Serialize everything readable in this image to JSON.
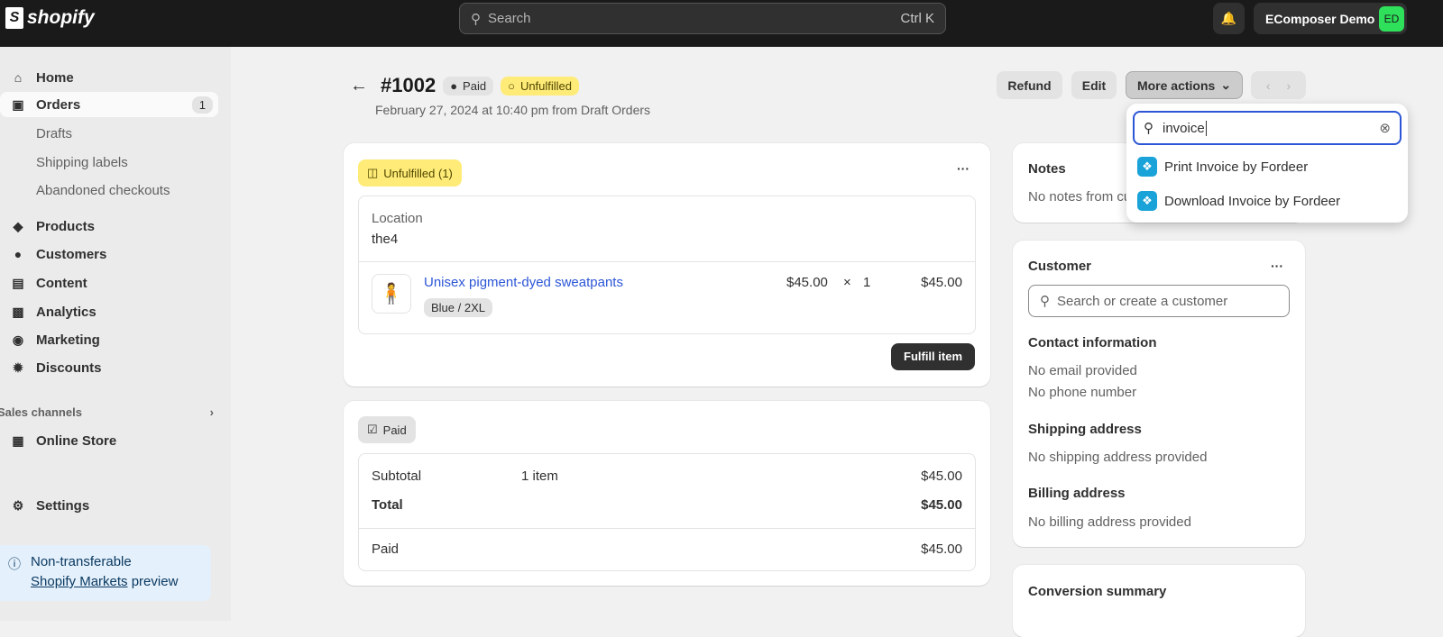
{
  "topbar": {
    "brand": "shopify",
    "search_placeholder": "Search",
    "search_shortcut": "Ctrl K",
    "store_name": "EComposer Demo",
    "store_initials": "ED"
  },
  "sidebar": {
    "items": [
      {
        "label": "Home"
      },
      {
        "label": "Orders",
        "count": "1"
      },
      {
        "label": "Drafts"
      },
      {
        "label": "Shipping labels"
      },
      {
        "label": "Abandoned checkouts"
      },
      {
        "label": "Products"
      },
      {
        "label": "Customers"
      },
      {
        "label": "Content"
      },
      {
        "label": "Analytics"
      },
      {
        "label": "Marketing"
      },
      {
        "label": "Discounts"
      }
    ],
    "sales_channels": "Sales channels",
    "online_store": "Online Store",
    "settings": "Settings",
    "notice": {
      "line1": "Non-transferable",
      "link": "Shopify Markets",
      "after": " preview"
    }
  },
  "order": {
    "number": "#1002",
    "payment_badge": "Paid",
    "fulfillment_badge": "Unfulfilled",
    "date": "February 27, 2024 at 10:40 pm from Draft Orders",
    "actions": {
      "refund": "Refund",
      "edit": "Edit",
      "more": "More actions"
    }
  },
  "fulfillment": {
    "badge": "Unfulfilled (1)",
    "location_label": "Location",
    "location": "the4",
    "item": {
      "name": "Unisex pigment-dyed sweatpants",
      "variant": "Blue / 2XL",
      "price": "$45.00",
      "qty": "1",
      "total": "$45.00"
    },
    "fulfill_button": "Fulfill item"
  },
  "payment": {
    "badge": "Paid",
    "subtotal_label": "Subtotal",
    "subtotal_items": "1 item",
    "subtotal": "$45.00",
    "total_label": "Total",
    "total": "$45.00",
    "paid_label": "Paid",
    "paid": "$45.00"
  },
  "notes": {
    "title": "Notes",
    "text": "No notes from customer"
  },
  "customer": {
    "title": "Customer",
    "search_placeholder": "Search or create a customer",
    "contact_title": "Contact information",
    "email": "No email provided",
    "phone": "No phone number",
    "shipping_title": "Shipping address",
    "shipping": "No shipping address provided",
    "billing_title": "Billing address",
    "billing": "No billing address provided"
  },
  "conversion": {
    "title": "Conversion summary"
  },
  "dropdown": {
    "query": "invoice",
    "items": [
      {
        "label": "Print Invoice by Fordeer"
      },
      {
        "label": "Download Invoice by Fordeer"
      }
    ]
  }
}
